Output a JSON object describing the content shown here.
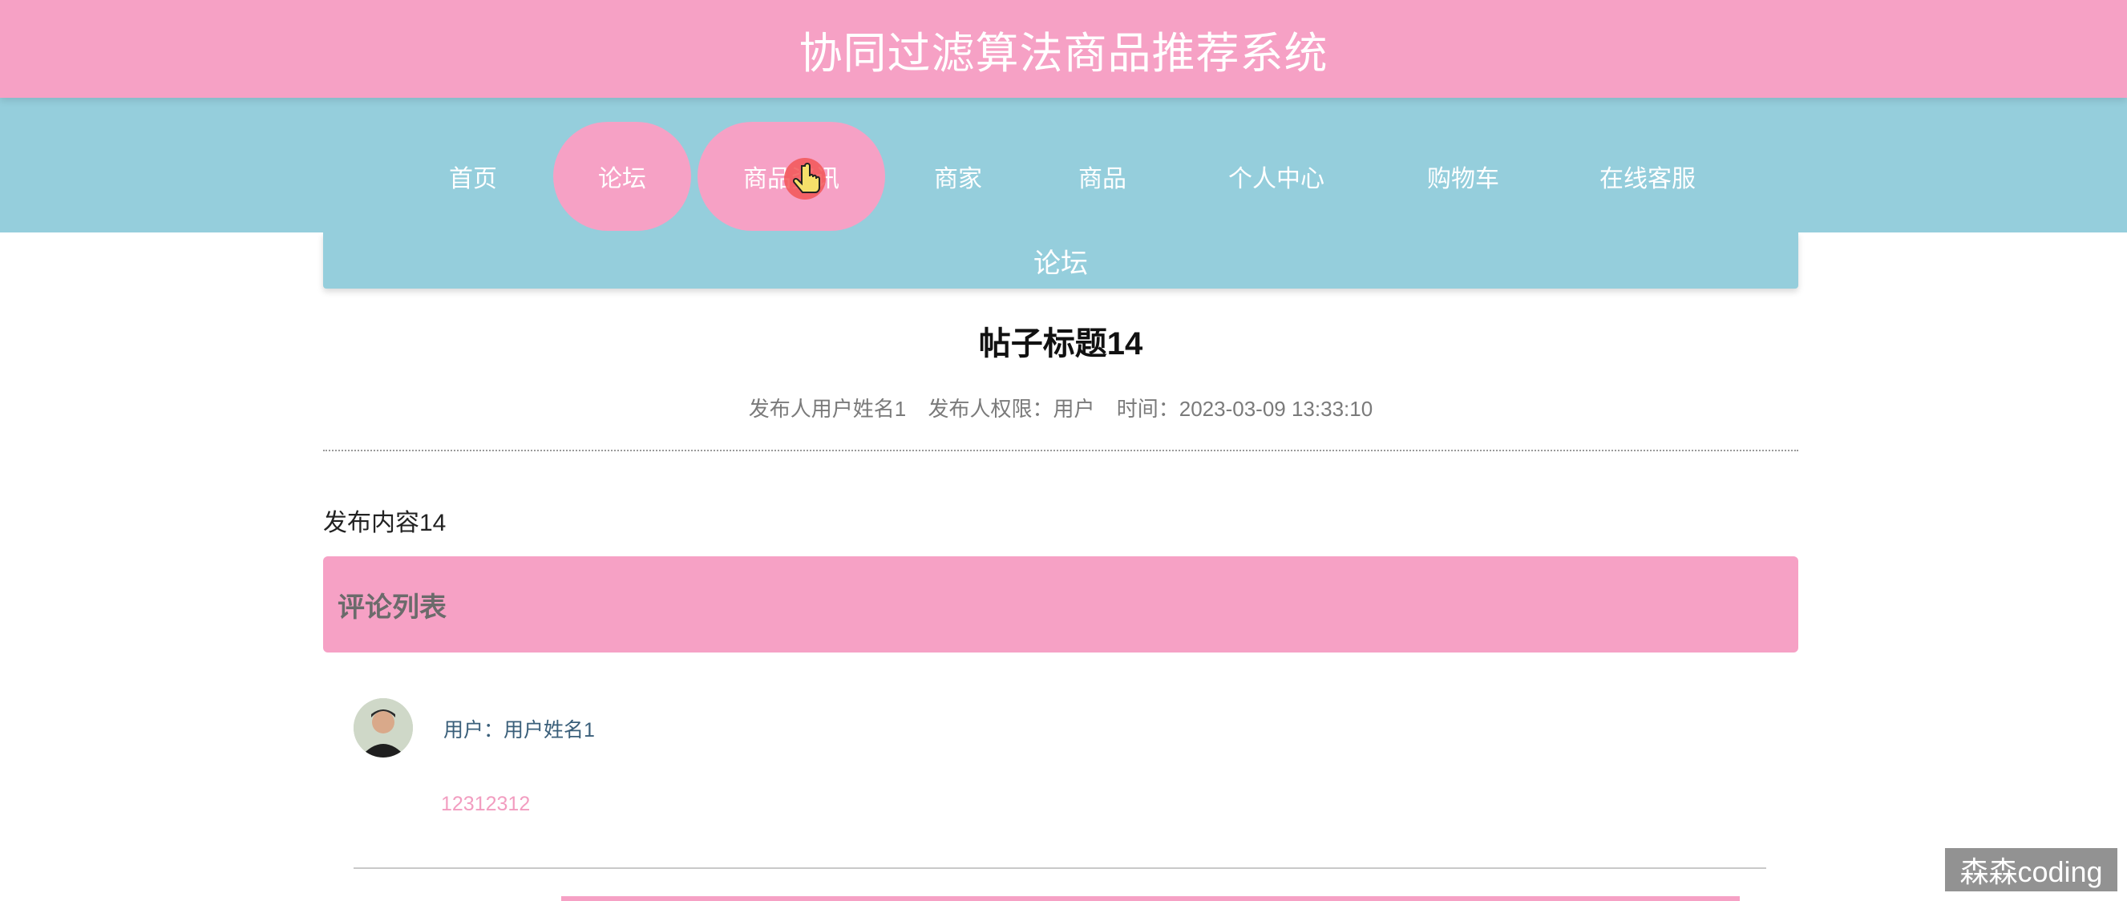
{
  "header": {
    "title": "协同过滤算法商品推荐系统"
  },
  "nav": {
    "items": [
      {
        "label": "首页"
      },
      {
        "label": "论坛"
      },
      {
        "label": "商品资讯"
      },
      {
        "label": "商家"
      },
      {
        "label": "商品"
      },
      {
        "label": "个人中心"
      },
      {
        "label": "购物车"
      },
      {
        "label": "在线客服"
      }
    ]
  },
  "section": {
    "title": "论坛"
  },
  "post": {
    "title": "帖子标题14",
    "author": "发布人用户姓名1",
    "role": "发布人权限：用户",
    "time": "时间：2023-03-09 13:33:10",
    "content": "发布内容14"
  },
  "comments": {
    "header": "评论列表",
    "items": [
      {
        "user": "用户：用户姓名1",
        "text": "12312312"
      }
    ]
  },
  "watermark": {
    "text": "森森coding"
  },
  "colors": {
    "pink": "#f6a1c5",
    "blue": "#95cedc",
    "comment_text": "#f29dc0",
    "username": "#3a5f7a"
  }
}
